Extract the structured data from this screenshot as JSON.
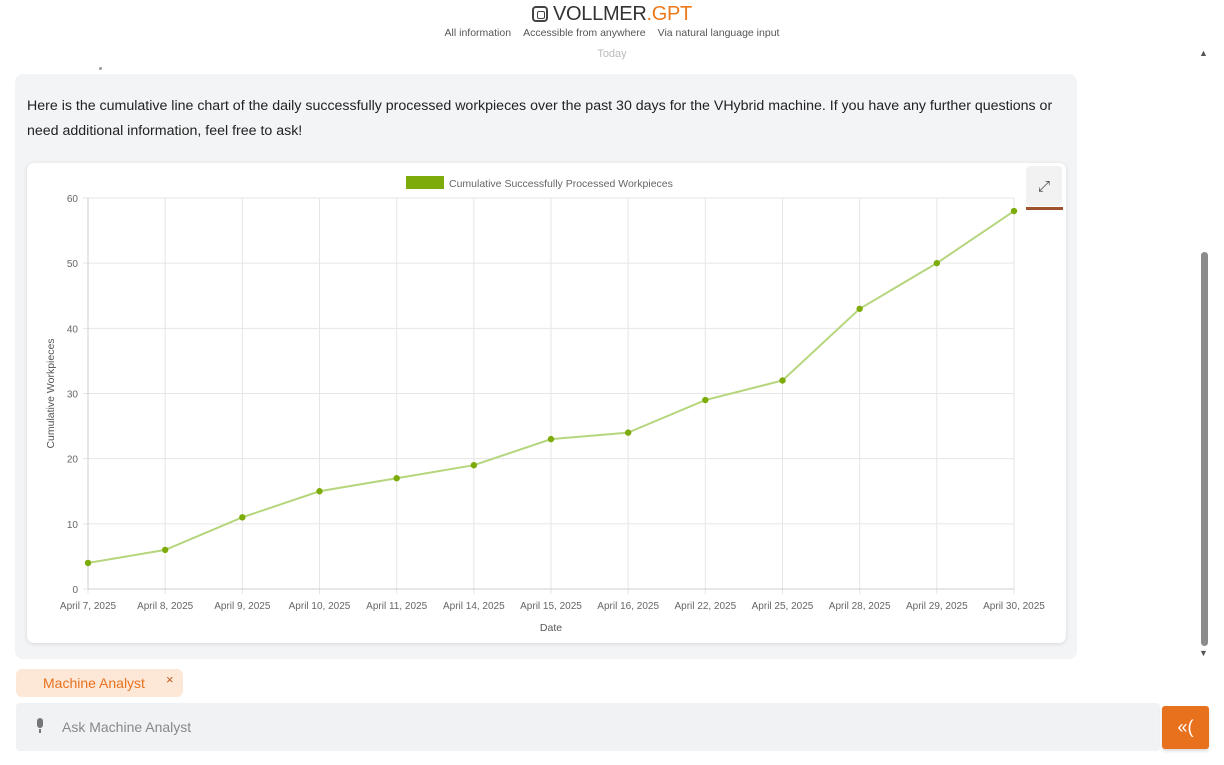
{
  "header": {
    "brand_name": "VOLLMER",
    "brand_suffix": ".GPT",
    "taglines": [
      "All information",
      "Accessible from anywhere",
      "Via natural language input"
    ],
    "date_separator": "Today"
  },
  "message": {
    "text": "Here is the cumulative line chart of the daily successfully processed workpieces over the past 30 days for the VHybrid machine. If you have any further questions or need additional information, feel free to ask!"
  },
  "chart_data": {
    "type": "line",
    "title": "",
    "xlabel": "Date",
    "ylabel": "Cumulative Workpieces",
    "categories": [
      "April 7, 2025",
      "April 8, 2025",
      "April 9, 2025",
      "April 10, 2025",
      "April 11, 2025",
      "April 14, 2025",
      "April 15, 2025",
      "April 16, 2025",
      "April 22, 2025",
      "April 25, 2025",
      "April 28, 2025",
      "April 29, 2025",
      "April 30, 2025"
    ],
    "series": [
      {
        "name": "Cumulative Successfully Processed Workpieces",
        "values": [
          4,
          6,
          11,
          15,
          17,
          19,
          23,
          24,
          29,
          32,
          43,
          50,
          58
        ]
      }
    ],
    "ylim": [
      0,
      60
    ],
    "yticks": [
      0,
      10,
      20,
      30,
      40,
      50,
      60
    ],
    "grid": true,
    "legend": "top-center",
    "line_color": "#b5d67c",
    "marker_color": "#7cab0a",
    "legend_color": "#7cab0a"
  },
  "agent": {
    "label": "Machine Analyst",
    "close": "×"
  },
  "input": {
    "placeholder": "Ask Machine Analyst"
  },
  "send": {
    "label": "«("
  },
  "icons": {
    "expand": "⤢",
    "scroll_up": "▲",
    "scroll_down": "▼"
  },
  "colors": {
    "accent": "#e8711e",
    "chip_bg": "#fde8d8"
  }
}
